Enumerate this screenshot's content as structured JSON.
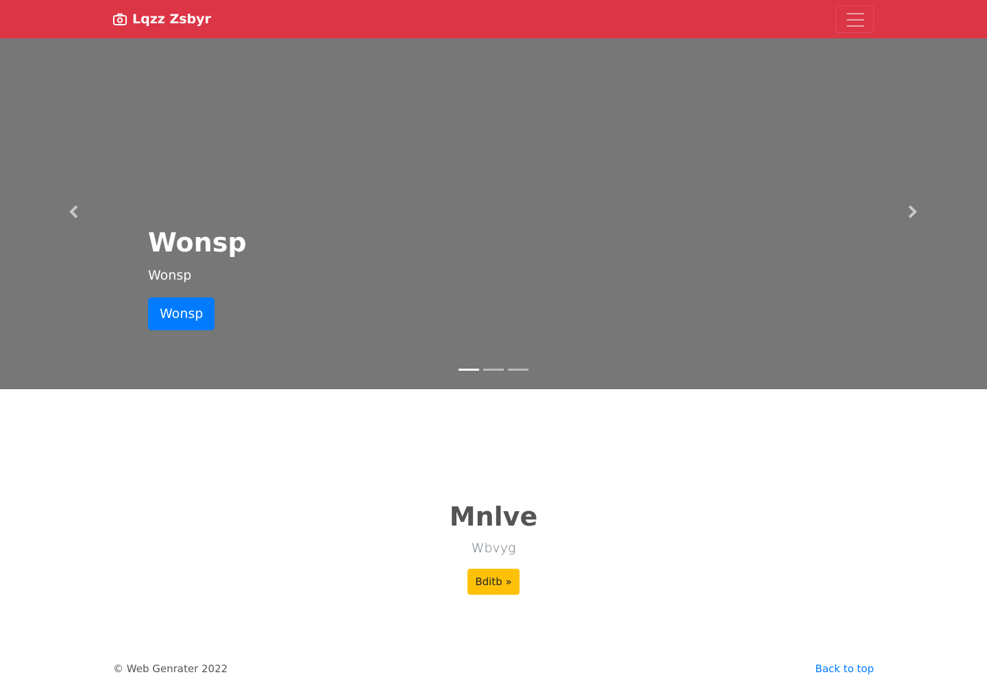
{
  "navbar": {
    "brand": "Lqzz Zsbyr",
    "brand_icon": "camera-icon",
    "toggler_icon": "hamburger-menu-icon",
    "background": "#dc3545"
  },
  "carousel": {
    "background": "#777777",
    "slide": {
      "title": "Wonsp",
      "text": "Wonsp",
      "button_label": "Wonsp"
    },
    "prev_icon": "chevron-left-icon",
    "next_icon": "chevron-right-icon",
    "indicators": [
      {
        "active": true
      },
      {
        "active": false
      },
      {
        "active": false
      }
    ]
  },
  "main": {
    "heading": "Mnlve",
    "lead": "Wbvyg",
    "button_label": "Bditb »"
  },
  "footer": {
    "copyright": "© Web Genrater 2022",
    "back_to_top": "Back to top"
  },
  "colors": {
    "primary": "#007bff",
    "warning": "#ffc107",
    "danger": "#dc3545"
  }
}
